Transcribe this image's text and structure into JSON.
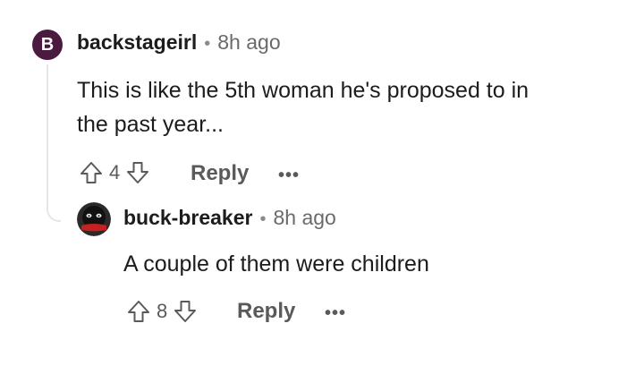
{
  "comments": [
    {
      "avatar_letter": "B",
      "username": "backstageirl",
      "separator": "•",
      "time": "8h ago",
      "text_line1": "This is like the 5th woman he's proposed to in",
      "text_line2": "the past year...",
      "votes": "4",
      "reply_label": "Reply",
      "more_label": "•••"
    },
    {
      "username": "buck-breaker",
      "separator": "•",
      "time": "8h ago",
      "text": "A couple of them were children",
      "votes": "8",
      "reply_label": "Reply",
      "more_label": "•••"
    }
  ],
  "icons": {
    "upvote": "arrow-up-outline",
    "downvote": "arrow-down-outline",
    "more": "ellipsis"
  },
  "colors": {
    "avatar_b_bg": "#4a1a3f",
    "muted_text": "#5a5a5a",
    "thread_line": "#e6e6e6"
  }
}
